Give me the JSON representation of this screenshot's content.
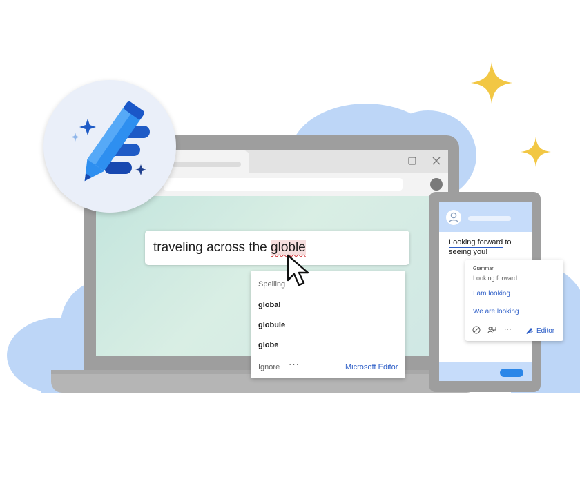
{
  "colors": {
    "accent": "#2d5ec7",
    "error": "#d13438",
    "cloud": "#bdd6f7",
    "sparkle": "#f2c744"
  },
  "browser": {
    "maximize_icon": "maximize-icon",
    "close_icon": "close-icon"
  },
  "document": {
    "text_before": "traveling across the ",
    "flagged_word": "globle"
  },
  "spelling_popup": {
    "label": "Spelling",
    "suggestions": [
      "global",
      "globule",
      "globe"
    ],
    "ignore_label": "Ignore",
    "more_label": "···",
    "brand_label": "Microsoft Editor"
  },
  "phone": {
    "message_underlined": "Looking forward",
    "message_rest": " to seeing you!"
  },
  "grammar_popup": {
    "label": "Grammar",
    "original": "Looking forward",
    "suggestions": [
      "I am looking",
      "We are looking"
    ],
    "more_label": "···",
    "editor_label": "Editor"
  }
}
